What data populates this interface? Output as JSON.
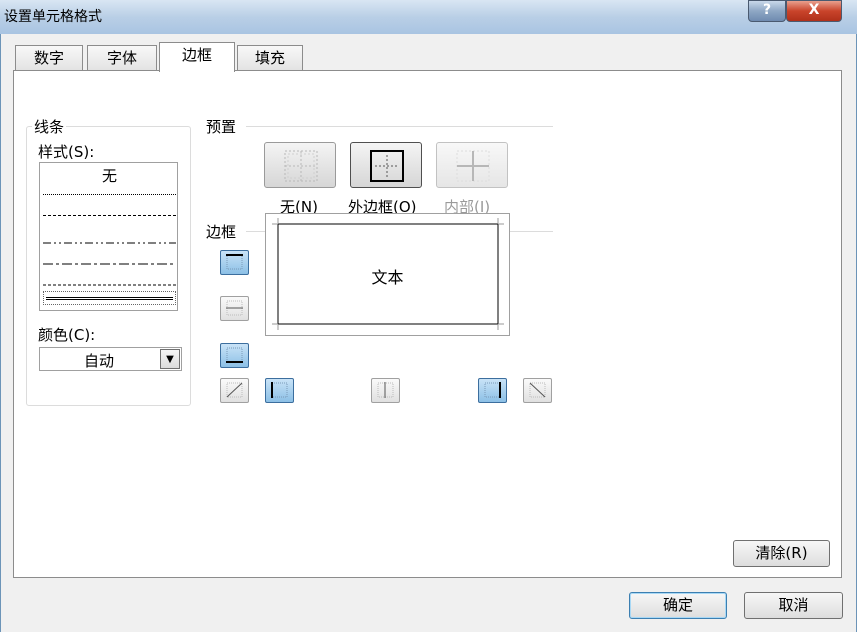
{
  "window": {
    "title": "设置单元格格式",
    "help_label": "?",
    "close_label": "X"
  },
  "tabs": [
    {
      "label": "数字",
      "active": false
    },
    {
      "label": "字体",
      "active": false
    },
    {
      "label": "边框",
      "active": true
    },
    {
      "label": "填充",
      "active": false
    }
  ],
  "line_group": {
    "title": "线条",
    "style_label": "样式(S):",
    "styles": [
      "无",
      "dotted-fine",
      "dotted",
      "dash-dot-dot",
      "dash-dot",
      "dashed",
      "double"
    ],
    "color_label": "颜色(C):",
    "color_value": "自动"
  },
  "presets": {
    "title": "预置",
    "items": [
      {
        "label": "无(N)",
        "icon": "preset-none-icon",
        "enabled": true
      },
      {
        "label": "外边框(O)",
        "icon": "preset-outline-icon",
        "enabled": true
      },
      {
        "label": "内部(I)",
        "icon": "preset-inside-icon",
        "enabled": false
      }
    ]
  },
  "border": {
    "title": "边框",
    "preview_text": "文本",
    "buttons": [
      {
        "name": "border-top",
        "on": true
      },
      {
        "name": "border-inner-horizontal",
        "on": false
      },
      {
        "name": "border-bottom",
        "on": true
      },
      {
        "name": "border-diagonal-up",
        "on": false
      },
      {
        "name": "border-left",
        "on": true
      },
      {
        "name": "border-inner-vertical",
        "on": false
      },
      {
        "name": "border-right",
        "on": true
      },
      {
        "name": "border-diagonal-down",
        "on": false
      }
    ]
  },
  "buttons": {
    "clear": "清除(R)",
    "ok": "确定",
    "cancel": "取消"
  }
}
